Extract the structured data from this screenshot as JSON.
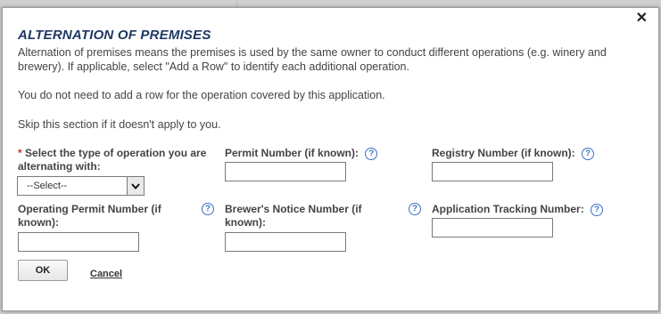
{
  "dialog": {
    "title": "ALTERNATION OF PREMISES",
    "paragraphs": [
      "Alternation of premises means the premises is used by the same owner to conduct different operations (e.g. winery and brewery). If applicable, select \"Add a Row\" to identify each additional operation.",
      "You do not need to add a row for the operation covered by this application.",
      "Skip this section if it doesn't apply to you."
    ],
    "close_symbol": "✕"
  },
  "fields": {
    "operation_type": {
      "required_mark": "*",
      "label": "Select the type of operation you are alternating with:",
      "selected": "--Select--"
    },
    "permit_number": {
      "label": "Permit Number (if known):",
      "value": ""
    },
    "registry_number": {
      "label": "Registry Number (if known):",
      "value": ""
    },
    "operating_permit_number": {
      "label": "Operating Permit Number (if known):",
      "value": ""
    },
    "brewers_notice_number": {
      "label": "Brewer's Notice Number (if known):",
      "value": ""
    },
    "application_tracking_number": {
      "label": "Application Tracking Number:",
      "value": ""
    }
  },
  "help_symbol": "?",
  "buttons": {
    "ok": "OK",
    "cancel": "Cancel"
  },
  "icons": {
    "close": "close-icon",
    "help": "help-icon",
    "dropdown": "chevron-down-icon"
  },
  "colors": {
    "title": "#1f3864",
    "required": "#c0392b",
    "help": "#3a6fc4"
  }
}
